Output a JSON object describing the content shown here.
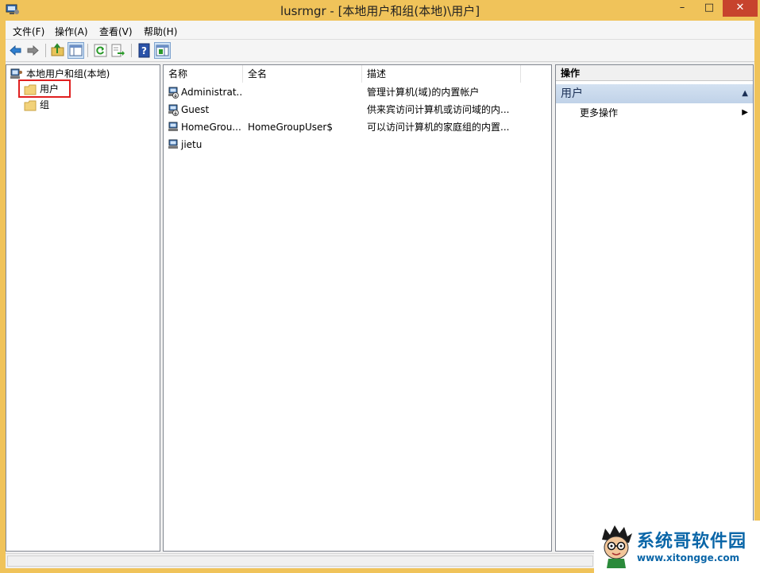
{
  "window": {
    "title": "lusrmgr - [本地用户和组(本地)\\用户]",
    "min": "–",
    "max": "□",
    "close": "✕"
  },
  "menu": [
    {
      "label": "文件(F)"
    },
    {
      "label": "操作(A)"
    },
    {
      "label": "查看(V)"
    },
    {
      "label": "帮助(H)"
    }
  ],
  "toolbar": [
    "back-icon",
    "forward-icon",
    "up-folder-icon",
    "show-hide-tree-icon",
    "refresh-icon",
    "export-list-icon",
    "help-icon",
    "show-hide-action-pane-icon"
  ],
  "tree": {
    "root": "本地用户和组(本地)",
    "items": [
      {
        "label": "用户",
        "selected": true
      },
      {
        "label": "组",
        "selected": false
      }
    ]
  },
  "list": {
    "columns": [
      "名称",
      "全名",
      "描述"
    ],
    "rows": [
      {
        "name": "Administrat...",
        "fullname": "",
        "description": "管理计算机(域)的内置帐户",
        "disabled": true
      },
      {
        "name": "Guest",
        "fullname": "",
        "description": "供来宾访问计算机或访问域的内...",
        "disabled": true
      },
      {
        "name": "HomeGrou...",
        "fullname": "HomeGroupUser$",
        "description": "可以访问计算机的家庭组的内置...",
        "disabled": false
      },
      {
        "name": "jietu",
        "fullname": "",
        "description": "",
        "disabled": false
      }
    ]
  },
  "actions": {
    "header": "操作",
    "group": "用户",
    "items": [
      {
        "label": "更多操作"
      }
    ]
  },
  "watermark": {
    "title": "系统哥软件园",
    "url": "www.xitongge.com"
  },
  "colors": {
    "titlebar": "#f0c35a",
    "close": "#c7432d",
    "accent": "#0a66a8",
    "highlight": "#e02020"
  }
}
